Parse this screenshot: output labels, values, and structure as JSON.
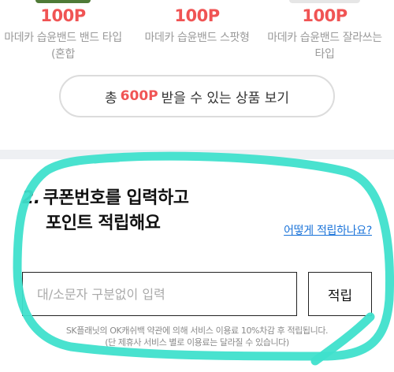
{
  "products": [
    {
      "points": "100P",
      "name": "마데카 습윤밴드 밴드 타입(혼합"
    },
    {
      "points": "100P",
      "name": "마데카 습윤밴드 스팟형"
    },
    {
      "points": "100P",
      "name": "마데카 습윤밴드 잘라쓰는 타입"
    }
  ],
  "view_all": {
    "prefix": "총",
    "points": "600P",
    "suffix": "받을 수 있는 상품 보기"
  },
  "coupon": {
    "step_number": "2.",
    "title_line1": "쿠폰번호를 입력하고",
    "title_line2": "포인트 적립해요",
    "help_link": "어떻게 적립하나요?",
    "input_placeholder": "대/소문자 구분없이 입력",
    "input_value": "",
    "submit_label": "적립",
    "notice_line1": "SK플래닛의 OK캐쉬백 약관에 의해 서비스 이용료 10%차감 후 적립됩니다.",
    "notice_line2": "(단 제휴사 서비스 별로 이용료는 달라질 수 있습니다)"
  },
  "colors": {
    "accent": "#f05454",
    "link": "#1a73d9",
    "annotation": "#3fe0cc"
  }
}
